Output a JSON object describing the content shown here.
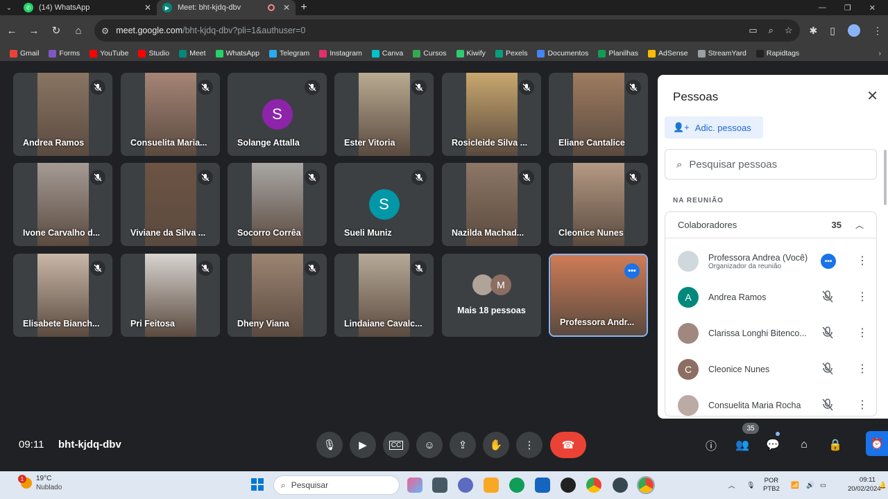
{
  "browser": {
    "tabs": [
      {
        "title": "(14) WhatsApp",
        "favicon_color": "#25d366",
        "active": false
      },
      {
        "title": "Meet: bht-kjdq-dbv",
        "favicon_color": "#00897b",
        "active": true
      }
    ],
    "url_host": "meet.google.com",
    "url_path": "/bht-kjdq-dbv?pli=1&authuser=0",
    "bookmarks": [
      {
        "label": "Gmail",
        "color": "#ea4335"
      },
      {
        "label": "Forms",
        "color": "#7e57c2"
      },
      {
        "label": "YouTube",
        "color": "#ff0000"
      },
      {
        "label": "Studio",
        "color": "#ff0000"
      },
      {
        "label": "Meet",
        "color": "#00897b"
      },
      {
        "label": "WhatsApp",
        "color": "#25d366"
      },
      {
        "label": "Telegram",
        "color": "#2aabee"
      },
      {
        "label": "Instagram",
        "color": "#e1306c"
      },
      {
        "label": "Canva",
        "color": "#00c4cc"
      },
      {
        "label": "Cursos",
        "color": "#34a853"
      },
      {
        "label": "Kiwify",
        "color": "#2ecc71"
      },
      {
        "label": "Pexels",
        "color": "#05a081"
      },
      {
        "label": "Documentos",
        "color": "#4285f4"
      },
      {
        "label": "Planilhas",
        "color": "#0f9d58"
      },
      {
        "label": "AdSense",
        "color": "#fbbc04"
      },
      {
        "label": "StreamYard",
        "color": "#9aa0a6"
      },
      {
        "label": "Rapidtags",
        "color": "#222222"
      }
    ]
  },
  "meet": {
    "tiles": [
      {
        "name": "Andrea Ramos",
        "type": "video",
        "photo": "#8a7563"
      },
      {
        "name": "Consuelita Maria...",
        "type": "video",
        "photo": "#a58576"
      },
      {
        "name": "Solange Attalla",
        "type": "avatar",
        "initial": "S",
        "avatar_color": "#8e24aa"
      },
      {
        "name": "Ester Vitoria",
        "type": "video",
        "photo": "#b9ab92"
      },
      {
        "name": "Rosicleide Silva ...",
        "type": "video",
        "photo": "#c9a86e"
      },
      {
        "name": "Eliane Cantalice",
        "type": "video",
        "photo": "#9e7c60"
      },
      {
        "name": "Ivone Carvalho d...",
        "type": "video",
        "photo": "#a59b95"
      },
      {
        "name": "Viviane da Silva ...",
        "type": "video",
        "photo": "#6d5444"
      },
      {
        "name": "Socorro Corrêa",
        "type": "video",
        "photo": "#a9a7a4"
      },
      {
        "name": "Sueli Muniz",
        "type": "avatar",
        "initial": "S",
        "avatar_color": "#0097a7"
      },
      {
        "name": "Nazilda Machad...",
        "type": "video",
        "photo": "#8d7766"
      },
      {
        "name": "Cleonice Nunes",
        "type": "video",
        "photo": "#b59a84"
      },
      {
        "name": "Elisabete Bianch...",
        "type": "video",
        "photo": "#c9b8a8"
      },
      {
        "name": "Pri Feitosa",
        "type": "video",
        "photo": "#d8d4d0"
      },
      {
        "name": "Dheny Viana",
        "type": "video",
        "photo": "#9c8472"
      },
      {
        "name": "Lindaiane Cavalc...",
        "type": "video",
        "photo": "#b7aa98"
      },
      {
        "name": "Mais 18 pessoas",
        "type": "others"
      },
      {
        "name": "Professora Andr...",
        "type": "self",
        "photo": "#cf7c56"
      }
    ],
    "others_initial": "M",
    "meeting_time": "09:11",
    "meeting_code": "bht-kjdq-dbv",
    "participant_count": "35"
  },
  "people_panel": {
    "title": "Pessoas",
    "add_label": "Adic. pessoas",
    "search_placeholder": "Pesquisar pessoas",
    "section_label": "NA REUNIÃO",
    "group_label": "Colaboradores",
    "group_count": "35",
    "people": [
      {
        "name": "Professora Andrea (Você)",
        "role": "Organizador da reunião",
        "avatar": "photo",
        "color": "#cfd8dc",
        "initial": ""
      },
      {
        "name": "Andrea Ramos",
        "role": "",
        "avatar": "initial",
        "color": "#00897b",
        "initial": "A"
      },
      {
        "name": "Clarissa Longhi Bitenco...",
        "role": "",
        "avatar": "photo",
        "color": "#a1887f",
        "initial": ""
      },
      {
        "name": "Cleonice Nunes",
        "role": "",
        "avatar": "initial",
        "color": "#8d6e63",
        "initial": "C"
      },
      {
        "name": "Consuelita Maria Rocha",
        "role": "",
        "avatar": "photo",
        "color": "#bcaaa4",
        "initial": ""
      }
    ]
  },
  "taskbar": {
    "weather_temp": "19°C",
    "weather_desc": "Nublado",
    "weather_badge": "1",
    "search_label": "Pesquisar",
    "lang_line1": "POR",
    "lang_line2": "PTB2",
    "clock_time": "09:11",
    "clock_date": "20/02/2024"
  }
}
